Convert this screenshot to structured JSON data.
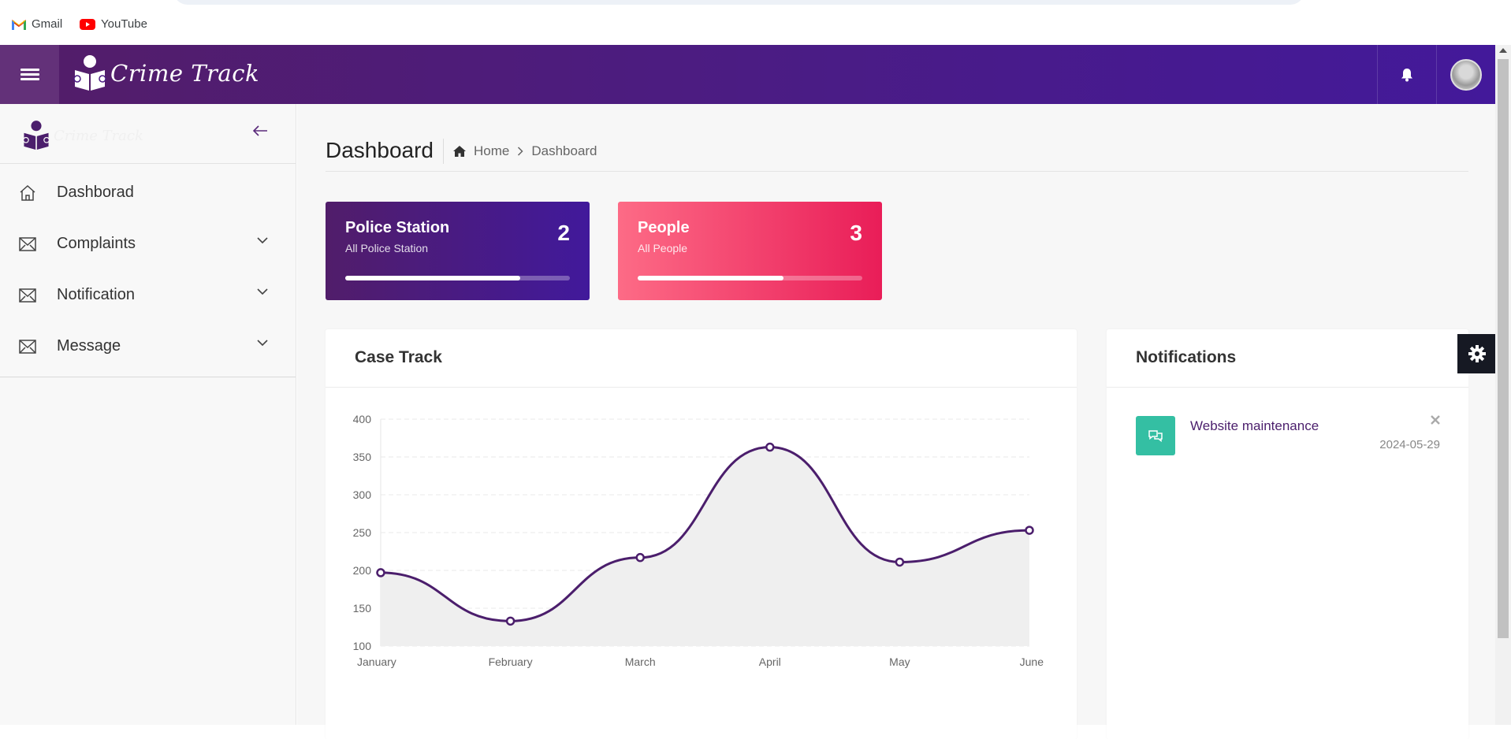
{
  "bookmarks": [
    {
      "label": "Gmail",
      "icon": "gmail-icon"
    },
    {
      "label": "YouTube",
      "icon": "youtube-icon"
    }
  ],
  "header": {
    "brand": "Crime Track",
    "icons": [
      "menu-icon",
      "bell-icon",
      "avatar"
    ]
  },
  "sidebar": {
    "brand_faded": "Crime Track",
    "items": [
      {
        "label": "Dashborad",
        "icon": "home-icon",
        "expandable": false
      },
      {
        "label": "Complaints",
        "icon": "envelope-icon",
        "expandable": true
      },
      {
        "label": "Notification",
        "icon": "envelope-icon",
        "expandable": true
      },
      {
        "label": "Message",
        "icon": "envelope-icon",
        "expandable": true
      }
    ]
  },
  "page": {
    "title": "Dashboard",
    "breadcrumb": [
      "Home",
      "Dashboard"
    ]
  },
  "stats": [
    {
      "title": "Police Station",
      "subtitle": "All Police Station",
      "count": "2",
      "progress": 0.78,
      "color_start": "#511d6a",
      "color_end": "#41199b"
    },
    {
      "title": "People",
      "subtitle": "All People",
      "count": "3",
      "progress": 0.65,
      "color_start": "#fd6b86",
      "color_end": "#e91d58"
    }
  ],
  "case_track": {
    "title": "Case Track"
  },
  "chart_data": {
    "type": "area",
    "title": "Case Track",
    "categories": [
      "January",
      "February",
      "March",
      "April",
      "May",
      "June"
    ],
    "series": [
      {
        "values": [
          197,
          133,
          217,
          363,
          211,
          253
        ]
      }
    ],
    "ylim": [
      100,
      400
    ],
    "yticks": [
      100,
      150,
      200,
      250,
      300,
      350,
      400
    ],
    "grid": true,
    "line_color": "#4b1e6c",
    "fill_color": "#efefef"
  },
  "notifications": {
    "title": "Notifications",
    "items": [
      {
        "title": "Website maintenance",
        "date": "2024-05-29",
        "icon": "chat-icon"
      }
    ]
  },
  "colors": {
    "accent": "#4b1c83",
    "success": "#34bfa3"
  }
}
